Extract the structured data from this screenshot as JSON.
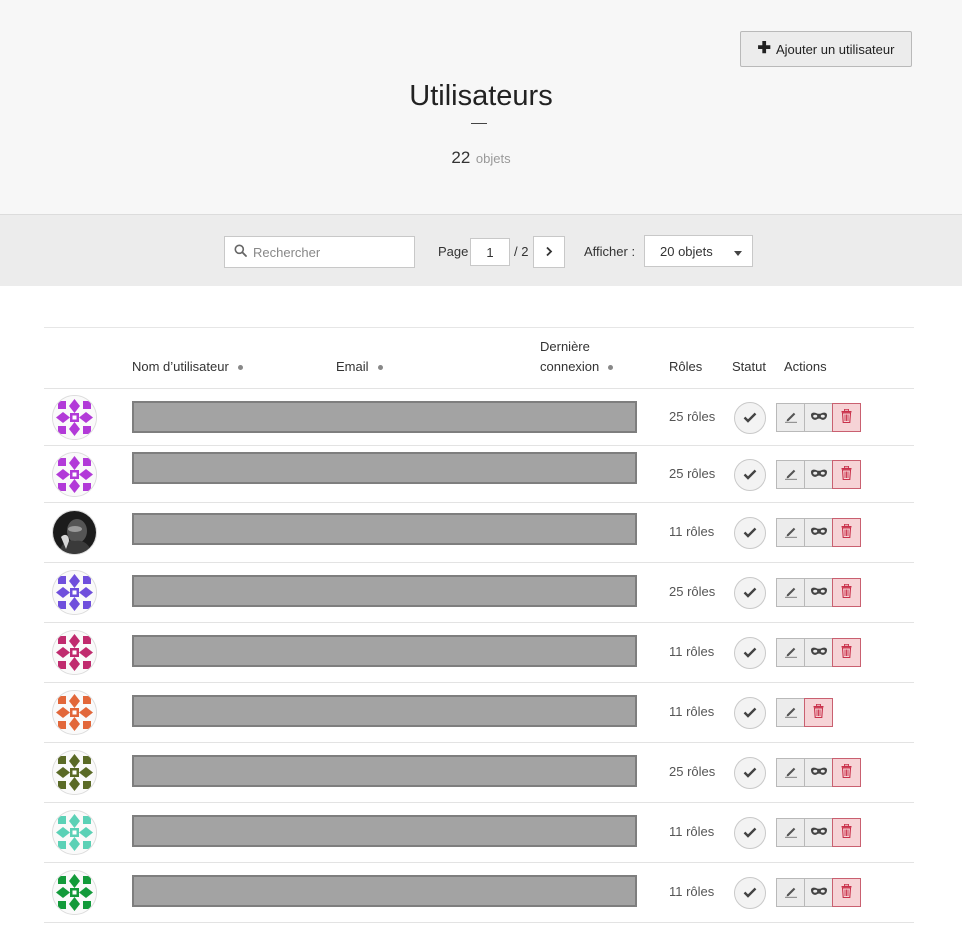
{
  "header": {
    "add_button_label": "Ajouter un utilisateur",
    "title": "Utilisateurs",
    "count": "22",
    "count_unit": "objets"
  },
  "toolbar": {
    "search_placeholder": "Rechercher",
    "page_label": "Page",
    "page_value": "1",
    "page_total": "/ 2",
    "show_label": "Afficher :",
    "show_selected": "20 objets"
  },
  "table": {
    "columns": {
      "username": "Nom d’utilisateur",
      "email": "Email",
      "last_login_line1": "Dernière",
      "last_login_line2": "connexion",
      "roles": "Rôles",
      "status": "Statut",
      "actions": "Actions"
    },
    "rows": [
      {
        "roles": "25 rôles",
        "status": "active",
        "impersonate": true,
        "avatar_color": "#b23ad8"
      },
      {
        "roles": "25 rôles",
        "status": "active",
        "impersonate": true,
        "avatar_color": "#b23ad8"
      },
      {
        "roles": "11 rôles",
        "status": "active",
        "impersonate": true,
        "avatar_color": "#222222"
      },
      {
        "roles": "25 rôles",
        "status": "active",
        "impersonate": true,
        "avatar_color": "#6f4fdc"
      },
      {
        "roles": "11 rôles",
        "status": "active",
        "impersonate": true,
        "avatar_color": "#c02b6e"
      },
      {
        "roles": "11 rôles",
        "status": "active",
        "impersonate": false,
        "avatar_color": "#e2673a"
      },
      {
        "roles": "25 rôles",
        "status": "active",
        "impersonate": true,
        "avatar_color": "#5a6a26"
      },
      {
        "roles": "11 rôles",
        "status": "active",
        "impersonate": true,
        "avatar_color": "#5bd1b6"
      },
      {
        "roles": "11 rôles",
        "status": "active",
        "impersonate": true,
        "avatar_color": "#129a3a"
      }
    ]
  },
  "icons": {
    "add": "plus-icon",
    "search": "search-icon",
    "next": "chevron-right-icon",
    "select": "caret-down-icon",
    "status": "check-icon",
    "edit": "pencil-icon",
    "impersonate": "mask-icon",
    "delete": "trash-icon"
  },
  "colors": {
    "delete_bg": "#f6d3d6",
    "delete_icon": "#c9304a",
    "redaction": "#a3a3a3"
  }
}
